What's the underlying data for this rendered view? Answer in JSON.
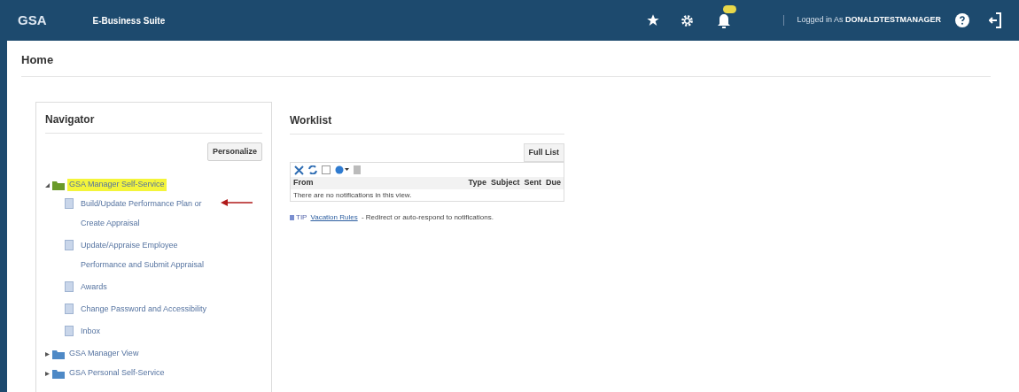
{
  "header": {
    "logo": "GSA",
    "app_name": "E-Business Suite",
    "logged_in_label": "Logged in As",
    "user": "DONALDTESTMANAGER"
  },
  "page_title": "Home",
  "navigator": {
    "title": "Navigator",
    "personalize": "Personalize",
    "tree": [
      {
        "label": "GSA Manager Self-Service",
        "expanded": true,
        "highlighted": true,
        "children": [
          {
            "label": "Build/Update Performance Plan or Create Appraisal",
            "pointed": true
          },
          {
            "label": "Update/Appraise Employee Performance and Submit Appraisal",
            "pointed": false
          },
          {
            "label": "Awards",
            "pointed": false
          },
          {
            "label": "Change Password and Accessibility",
            "pointed": false
          },
          {
            "label": "Inbox",
            "pointed": false
          }
        ]
      },
      {
        "label": "GSA Manager View",
        "expanded": false,
        "highlighted": false
      },
      {
        "label": "GSA Personal Self-Service",
        "expanded": false,
        "highlighted": false
      }
    ]
  },
  "worklist": {
    "title": "Worklist",
    "full_list": "Full List",
    "columns": [
      "From",
      "Type",
      "Subject",
      "Sent",
      "Due"
    ],
    "empty_message": "There are no notifications in this view.",
    "tip_label": "TIP",
    "tip_link": "Vacation Rules",
    "tip_text": " - Redirect or auto-respond to notifications."
  }
}
